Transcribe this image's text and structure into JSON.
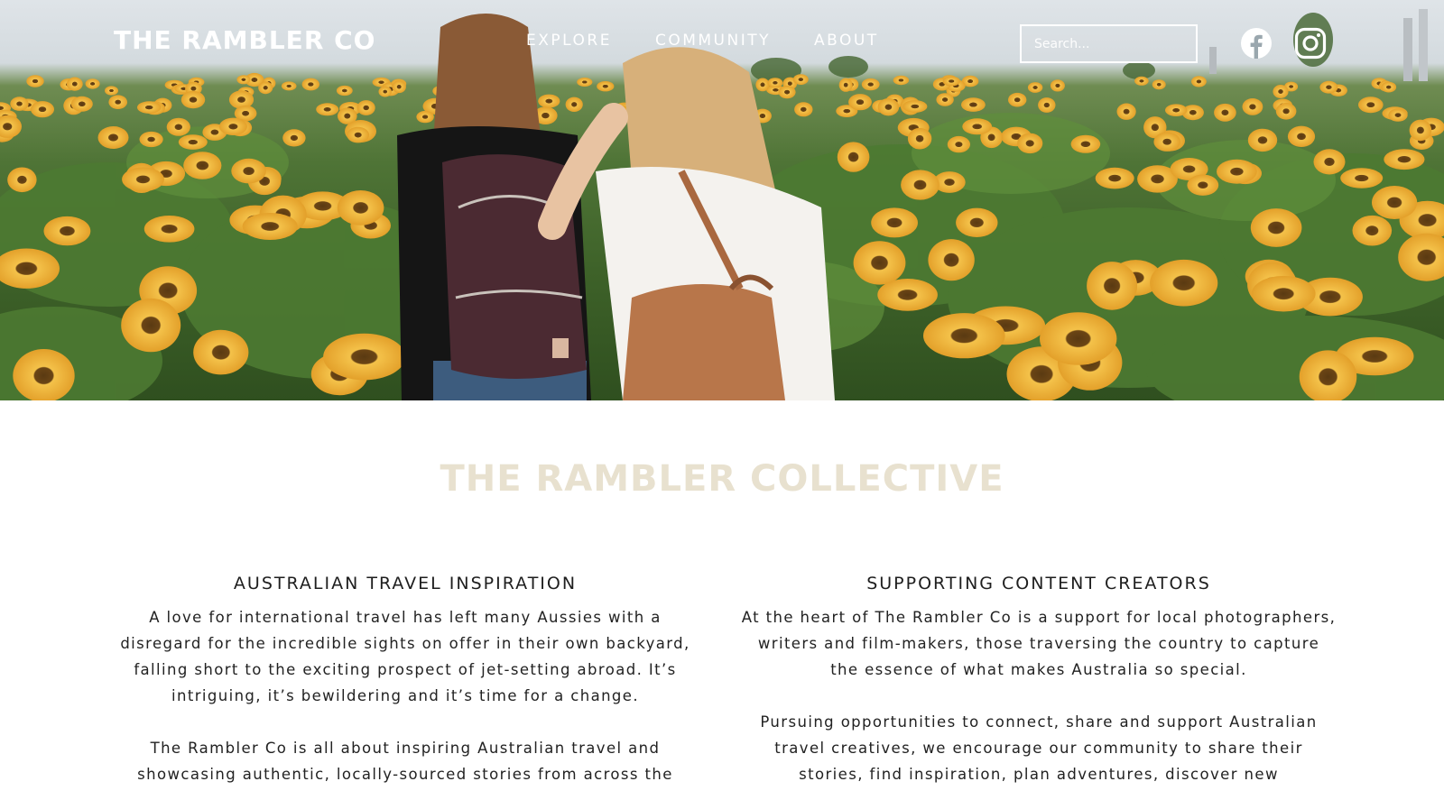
{
  "header": {
    "logo": "THE RAMBLER CO",
    "nav": [
      "EXPLORE",
      "COMMUNITY",
      "ABOUT"
    ],
    "search_placeholder": "Search..."
  },
  "social": {
    "facebook_icon": "facebook-icon",
    "instagram_icon": "instagram-icon"
  },
  "main": {
    "title": "THE RAMBLER COLLECTIVE",
    "columns": [
      {
        "heading": "AUSTRALIAN TRAVEL INSPIRATION",
        "paragraphs": [
          "A love for international travel has left many Aussies with a disregard for the incredible sights on offer in their own backyard, falling short to the exciting prospect of jet-setting abroad. It’s intriguing, it’s bewildering and it’s time for a change.",
          "The Rambler Co is all about inspiring Australian travel and showcasing authentic, locally-sourced stories from across the"
        ]
      },
      {
        "heading": "SUPPORTING CONTENT CREATORS",
        "paragraphs": [
          "At the heart of The Rambler Co is a support for local photographers, writers and film-makers, those traversing the country to capture the essence of what makes Australia so special.",
          "Pursuing opportunities to connect, share and support Australian travel creatives, we encourage our community to share their stories, find inspiration, plan adventures, discover new"
        ]
      }
    ]
  },
  "colors": {
    "title_color": "#e8e1cf",
    "sunflower": "#f2b53a",
    "foliage": "#3e6229"
  }
}
